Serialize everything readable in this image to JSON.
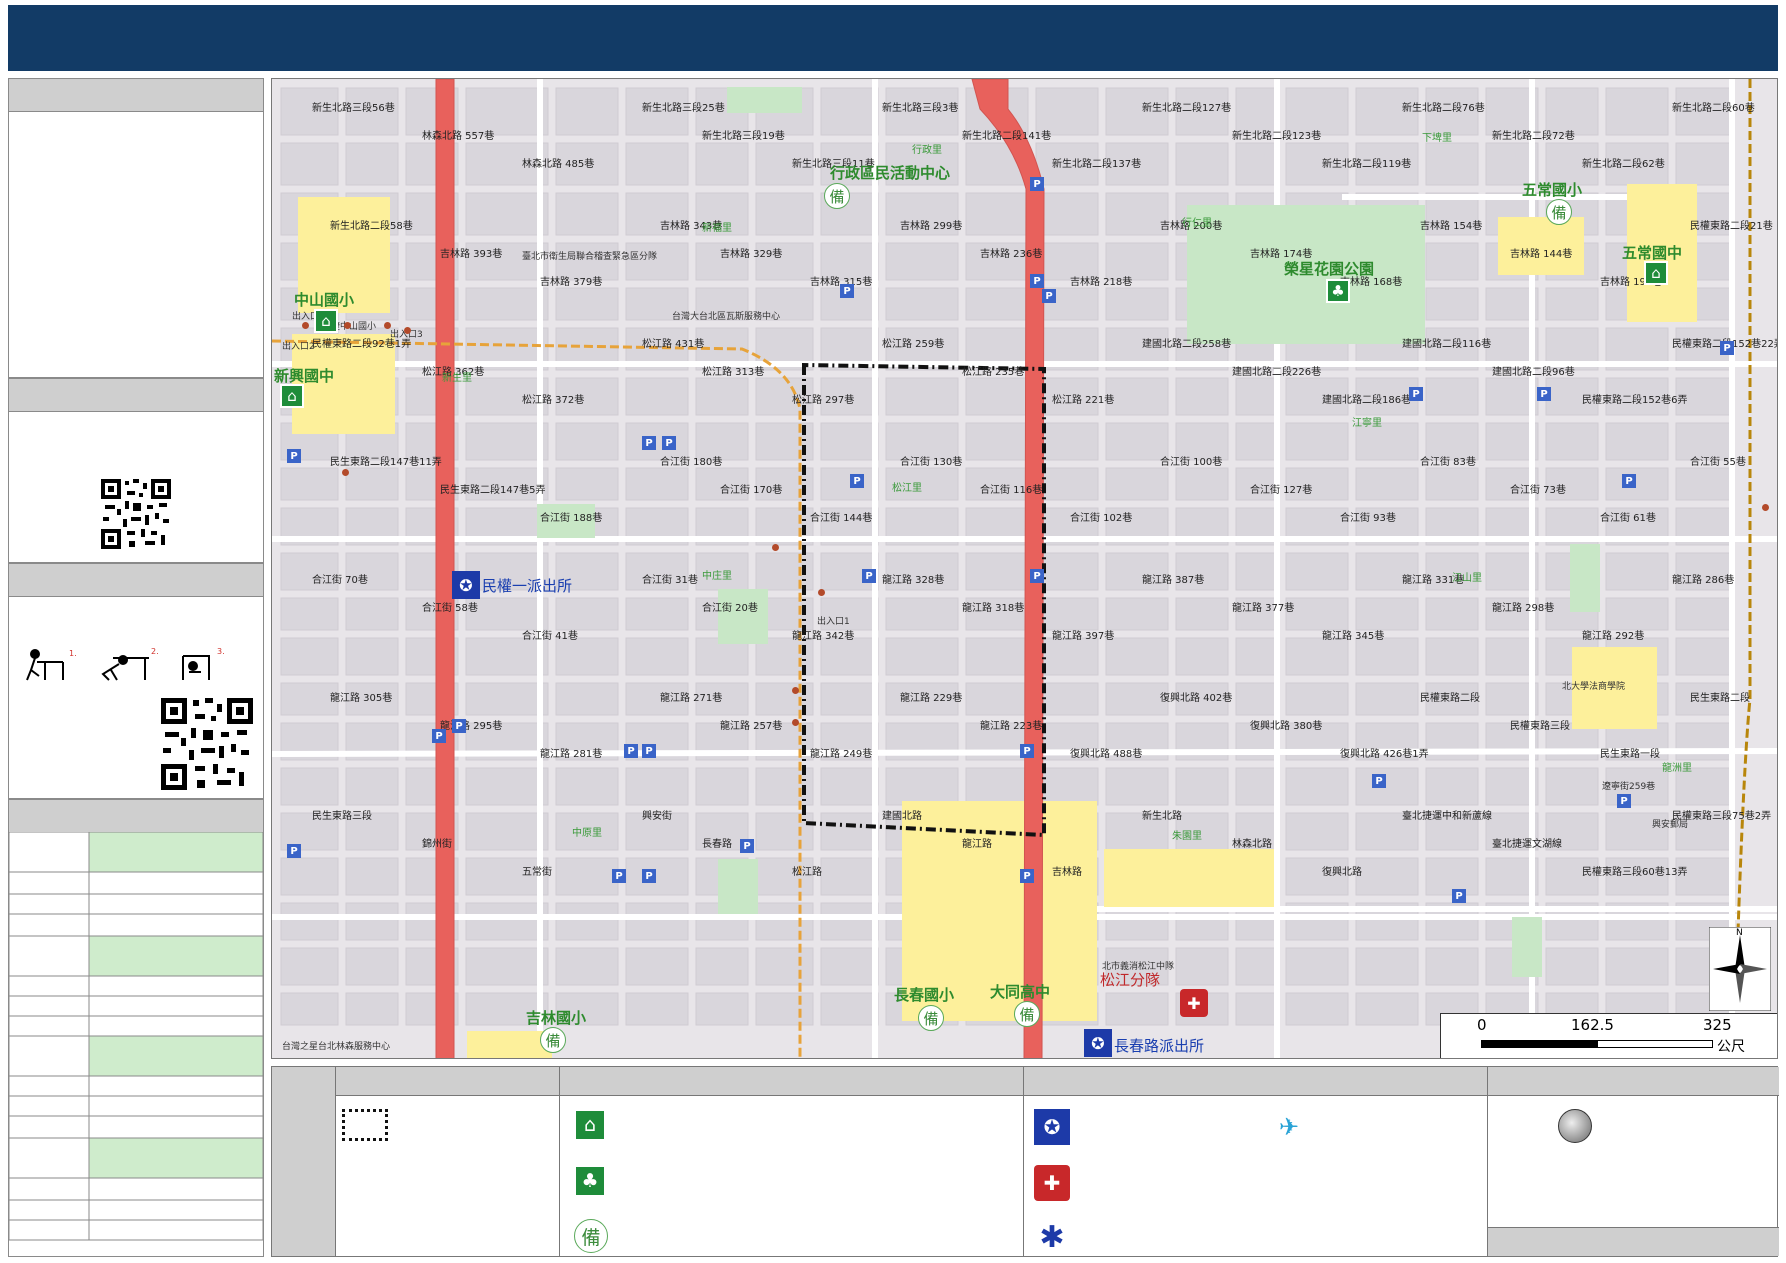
{
  "map": {
    "roads": [
      "新生北路三段56巷",
      "林森北路 557巷",
      "林森北路 485巷",
      "新生北路三段25巷",
      "新生北路三段19巷",
      "新生北路三段11巷",
      "新生北路三段3巷",
      "新生北路二段141巷",
      "新生北路二段137巷",
      "新生北路二段127巷",
      "新生北路二段123巷",
      "新生北路二段119巷",
      "新生北路二段76巷",
      "新生北路二段72巷",
      "新生北路二段62巷",
      "新生北路二段60巷",
      "新生北路二段58巷",
      "吉林路 393巷",
      "吉林路 379巷",
      "吉林路 343巷",
      "吉林路 329巷",
      "吉林路 315巷",
      "吉林路 299巷",
      "吉林路 236巷",
      "吉林路 218巷",
      "吉林路 200巷",
      "吉林路 174巷",
      "吉林路 168巷",
      "吉林路 154巷",
      "吉林路 144巷",
      "吉林路 199巷",
      "民權東路二段21巷",
      "民權東路二段92巷1弄",
      "松江路 362巷",
      "松江路 372巷",
      "松江路 431巷",
      "松江路 313巷",
      "松江路 297巷",
      "松江路 259巷",
      "松江路 235巷",
      "松江路 221巷",
      "建國北路二段258巷",
      "建國北路二段226巷",
      "建國北路二段186巷",
      "建國北路二段116巷",
      "建國北路二段96巷",
      "民權東路二段152巷6弄",
      "民權東路二段152巷22弄",
      "民生東路二段147巷11弄",
      "民生東路二段147巷5弄",
      "合江街 188巷",
      "合江街 180巷",
      "合江街 170巷",
      "合江街 144巷",
      "合江街 130巷",
      "合江街 116巷",
      "合江街 102巷",
      "合江街 100巷",
      "合江街 127巷",
      "合江街 93巷",
      "合江街 83巷",
      "合江街 73巷",
      "合江街 61巷",
      "合江街 55巷",
      "合江街 70巷",
      "合江街 58巷",
      "合江街 41巷",
      "合江街 31巷",
      "合江街 20巷",
      "龍江路 342巷",
      "龍江路 328巷",
      "龍江路 318巷",
      "龍江路 397巷",
      "龍江路 387巷",
      "龍江路 377巷",
      "龍江路 345巷",
      "龍江路 331巷",
      "龍江路 298巷",
      "龍江路 292巷",
      "龍江路 286巷",
      "龍江路 305巷",
      "龍江路 295巷",
      "龍江路 281巷",
      "龍江路 271巷",
      "龍江路 257巷",
      "龍江路 249巷",
      "龍江路 229巷",
      "龍江路 223巷",
      "復興北路 488巷",
      "復興北路 402巷",
      "復興北路 380巷",
      "復興北路 426巷1弄",
      "民權東路二段",
      "民權東路三段",
      "民生東路一段",
      "民生東路二段",
      "民生東路三段",
      "錦州街",
      "五常街",
      "興安街",
      "長春路",
      "松江路",
      "建國北路",
      "龍江路",
      "吉林路",
      "新生北路",
      "林森北路",
      "復興北路",
      "臺北捷運中和新蘆線",
      "臺北捷運文湖線",
      "民權東路三段60巷13弄",
      "民權東路三段75巷2弄"
    ],
    "pois": {
      "zhongshan_elem": "中山國小",
      "xinxing_junior": "新興國中",
      "minquan_police": "民權一派出所",
      "xingzheng_center": "行政區民活動中心",
      "rongxing_park": "榮星花園公園",
      "wuchang_elem": "五常國小",
      "wuchang_junior": "五常國中",
      "jilin_elem": "吉林國小",
      "changchun_elem": "長春國小",
      "datong_high": "大同高中",
      "songjiang_fire": "松江分隊",
      "changchun_police": "長春路派出所"
    },
    "districts": [
      "行政里",
      "新福里",
      "行仁里",
      "新生里",
      "松江里",
      "中庄里",
      "江寧里",
      "江山里",
      "朱園里",
      "下埤里",
      "中原里",
      "龍洲里"
    ],
    "misc_labels": [
      "出入口4",
      "出入口3",
      "出入口2",
      "出入口1",
      "北捷中山國小",
      "台灣大台北區瓦斯服務中心",
      "臺北市衛生局聯合稽查緊急區分隊",
      "北市義消松江中隊",
      "北大學法商學院",
      "遼寧街259巷",
      "興安郵局",
      "台灣之星台北林森服務中心"
    ],
    "scale": {
      "labels": [
        "0",
        "162.5",
        "325"
      ],
      "unit": "公尺"
    },
    "north": "N"
  },
  "colors": {
    "header": "#123b66",
    "panel_head": "#cfcfcf",
    "highlight_row": "#cfeccc",
    "mrt": "#e7a33a",
    "major_road": "#e8615c",
    "park": "#c8e7c6",
    "school": "#fdf09b",
    "background": "#e8e5e9"
  },
  "legend": {
    "icons": [
      "boundary-dashed-icon",
      "shelter-icon",
      "park-icon",
      "bei-icon",
      "police-icon",
      "fire-icon",
      "ambulance-icon",
      "helicopter-icon",
      "gray-circle-icon"
    ]
  }
}
